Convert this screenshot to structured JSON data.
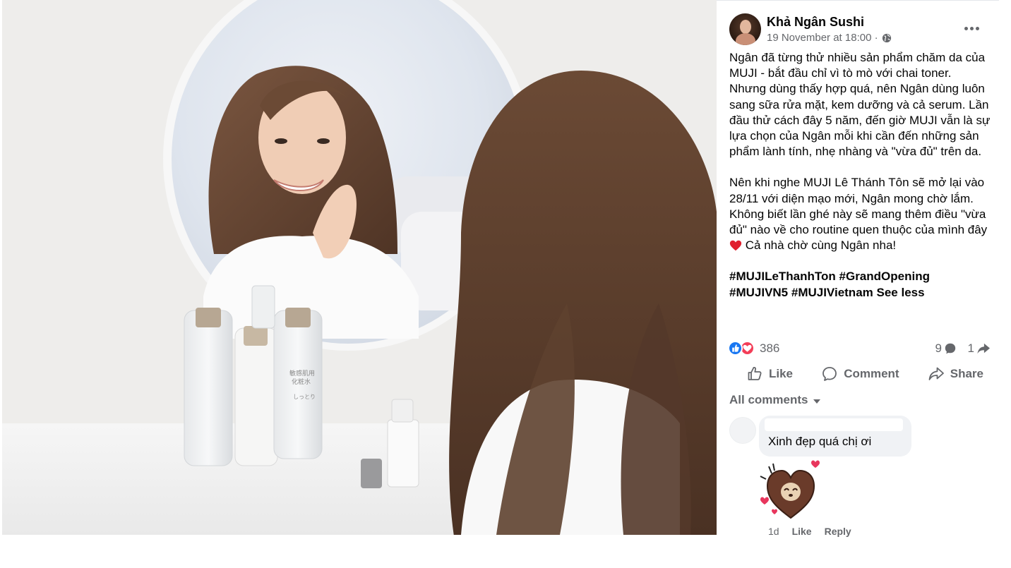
{
  "post": {
    "author": "Khả Ngân Sushi",
    "timestamp": "19 November at 18:00 ·",
    "paragraph1": "Ngân đã từng thử nhiều sản phẩm chăm da của MUJI - bắt đầu chỉ vì tò mò với chai toner. Nhưng dùng thấy hợp quá, nên Ngân dùng luôn sang sữa rửa mặt, kem dưỡng và cả serum. Lần đầu thử cách đây 5 năm, đến giờ MUJI vẫn là sự lựa chọn của Ngân mỗi khi cần đến những sản phẩm lành tính, nhẹ nhàng và \"vừa đủ\" trên da.",
    "paragraph2_a": "Nên khi nghe MUJI Lê Thánh Tôn sẽ mở lại vào 28/11 với diện mạo mới, Ngân mong chờ lắm. Không biết lần ghé này sẽ mang thêm điều \"vừa đủ\" nào về cho routine quen thuộc của mình đây",
    "paragraph2_b": "Cả nhà chờ cùng Ngân nha!",
    "hashtags": "#MUJILeThanhTon #GrandOpening #MUJIVN5 #MUJIVietnam",
    "see_less": "See less"
  },
  "stats": {
    "reactions": "386",
    "comments": "9",
    "shares": "1"
  },
  "actions": {
    "like": "Like",
    "comment": "Comment",
    "share": "Share"
  },
  "comments_section": {
    "filter_label": "All comments",
    "comment": {
      "text": "Xinh đẹp quá chị ơi",
      "time": "1d",
      "like": "Like",
      "reply": "Reply"
    }
  },
  "photo": {
    "bottle_labels": [
      "敏感肌用",
      "化粧水",
      "しっとり"
    ],
    "icons": [
      "globe-icon",
      "more-icon",
      "like-icon",
      "comment-icon",
      "share-icon",
      "heart-icon"
    ],
    "colors": {
      "reaction_like": "#1877f2",
      "reaction_love": "#f33e58",
      "secondary_text": "#65676b"
    }
  }
}
